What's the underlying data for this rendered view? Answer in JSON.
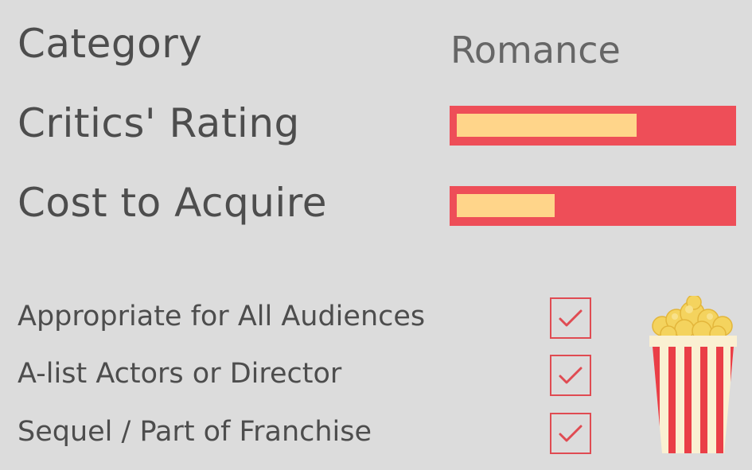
{
  "category": {
    "label": "Category",
    "value": "Romance"
  },
  "ratings": [
    {
      "label": "Critics' Rating",
      "level": 0.66
    },
    {
      "label": "Cost to Acquire",
      "level": 0.36
    }
  ],
  "checklist": [
    {
      "label": "Appropriate for All Audiences",
      "checked": true
    },
    {
      "label": "A-list Actors or Director",
      "checked": true
    },
    {
      "label": "Sequel / Part of Franchise",
      "checked": true
    }
  ],
  "colors": {
    "background": "#dcdcdc",
    "bar": "#ee4e58",
    "bar_fill": "#ffd58a",
    "check": "#e04b52",
    "text": "#4d4d4d"
  },
  "icons": {
    "popcorn": "popcorn-icon",
    "check": "checkmark-icon"
  }
}
